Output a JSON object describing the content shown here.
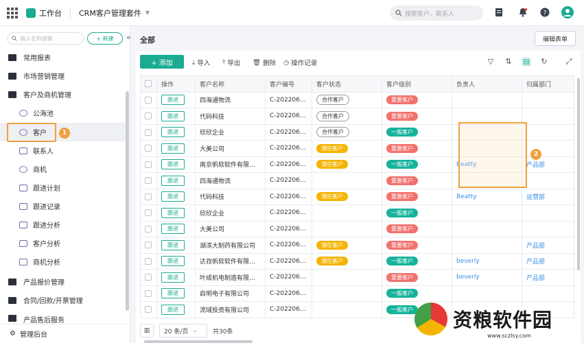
{
  "topbar": {
    "app_name": "工作台",
    "suite_name": "CRM客户管理套件",
    "search_placeholder": "搜索客户、联系人"
  },
  "sidebar": {
    "search_placeholder": "输入名称搜索",
    "new_label": "+ 新建",
    "items": [
      {
        "label": "常用报表",
        "level": 1,
        "icon": "folder-icon"
      },
      {
        "label": "市场营销管理",
        "level": 1,
        "icon": "folder-icon"
      },
      {
        "label": "客户及商机管理",
        "level": 1,
        "icon": "folder-icon"
      },
      {
        "label": "公海池",
        "level": 2,
        "icon": "users-icon"
      },
      {
        "label": "客户",
        "level": 2,
        "icon": "user-icon"
      },
      {
        "label": "联系人",
        "level": 2,
        "icon": "contact-icon"
      },
      {
        "label": "商机",
        "level": 2,
        "icon": "target-icon"
      },
      {
        "label": "跟进计划",
        "level": 2,
        "icon": "calendar-icon"
      },
      {
        "label": "跟进记录",
        "level": 2,
        "icon": "record-icon"
      },
      {
        "label": "跟进分析",
        "level": 2,
        "icon": "chart-icon"
      },
      {
        "label": "客户分析",
        "level": 2,
        "icon": "chart-icon"
      },
      {
        "label": "商机分析",
        "level": 2,
        "icon": "chart-icon"
      },
      {
        "label": "产品报价管理",
        "level": 1,
        "icon": "folder-icon"
      },
      {
        "label": "合同/回款/开票管理",
        "level": 1,
        "icon": "folder-icon"
      },
      {
        "label": "产品售后服务",
        "level": 1,
        "icon": "folder-icon"
      }
    ],
    "bottom_label": "管理后台",
    "marker_1": "1"
  },
  "main": {
    "title": "全部",
    "edit_form_label": "编辑表单",
    "add_label": "+ 添加",
    "toolbar": {
      "import": "导入",
      "export": "导出",
      "delete": "删除",
      "history": "操作记录"
    },
    "marker_2": "2",
    "columns": [
      "操作",
      "客户名称",
      "客户编号",
      "客户状态",
      "客户级别",
      "负责人",
      "归属部门"
    ],
    "follow_label": "跟进",
    "rows": [
      {
        "name": "四海通物流",
        "code": "C-20220608...",
        "status": "合作客户",
        "status_type": "coop",
        "level": "重要客户",
        "level_type": "imp",
        "owner": "",
        "dept": ""
      },
      {
        "name": "代码科技",
        "code": "C-20220608...",
        "status": "合作客户",
        "status_type": "coop",
        "level": "重要客户",
        "level_type": "imp",
        "owner": "",
        "dept": ""
      },
      {
        "name": "欣欣企业",
        "code": "C-20220608...",
        "status": "合作客户",
        "status_type": "coop",
        "level": "一般客户",
        "level_type": "gen",
        "owner": "",
        "dept": ""
      },
      {
        "name": "大美公司",
        "code": "C-20220608...",
        "status": "潜在客户",
        "status_type": "pot",
        "level": "重要客户",
        "level_type": "imp",
        "owner": "",
        "dept": ""
      },
      {
        "name": "南京帆软软件有限公...",
        "code": "C-20220608...",
        "status": "潜在客户",
        "status_type": "pot",
        "level": "一般客户",
        "level_type": "gen",
        "owner": "Beatty",
        "dept": "产品部"
      },
      {
        "name": "四海通物流",
        "code": "C-20220608...",
        "status": "",
        "status_type": "",
        "level": "重要客户",
        "level_type": "imp",
        "owner": "",
        "dept": ""
      },
      {
        "name": "代码科技",
        "code": "C-20220608...",
        "status": "潜在客户",
        "status_type": "pot",
        "level": "重要客户",
        "level_type": "imp",
        "owner": "Beatty",
        "dept": "运营部"
      },
      {
        "name": "欣欣企业",
        "code": "C-20220608...",
        "status": "",
        "status_type": "",
        "level": "一般客户",
        "level_type": "gen",
        "owner": "",
        "dept": ""
      },
      {
        "name": "大美公司",
        "code": "C-20220608...",
        "status": "",
        "status_type": "",
        "level": "重要客户",
        "level_type": "imp",
        "owner": "",
        "dept": ""
      },
      {
        "name": "湖滨大制药有限公司",
        "code": "C-20220607...",
        "status": "潜在客户",
        "status_type": "pot",
        "level": "重要客户",
        "level_type": "imp",
        "owner": "",
        "dept": "产品部"
      },
      {
        "name": "达孜帆软软件有限公...",
        "code": "C-20220607...",
        "status": "潜在客户",
        "status_type": "pot",
        "level": "一般客户",
        "level_type": "gen",
        "owner": "beverly",
        "dept": "产品部"
      },
      {
        "name": "叶成机电制造有限公...",
        "code": "C-20220602...",
        "status": "",
        "status_type": "",
        "level": "重要客户",
        "level_type": "imp",
        "owner": "beverly",
        "dept": "产品部"
      },
      {
        "name": "启明电子有限公司",
        "code": "C-20220602...",
        "status": "",
        "status_type": "",
        "level": "一般客户",
        "level_type": "gen",
        "owner": "",
        "dept": ""
      },
      {
        "name": "流域投资有限公司",
        "code": "C-20220602...",
        "status": "",
        "status_type": "",
        "level": "一般客户",
        "level_type": "gen",
        "owner": "",
        "dept": ""
      }
    ]
  },
  "pager": {
    "page_size": "20 条/页",
    "total": "共30条"
  },
  "watermark": {
    "title": "资粮软件园",
    "url": "www.sczlsy.com"
  }
}
